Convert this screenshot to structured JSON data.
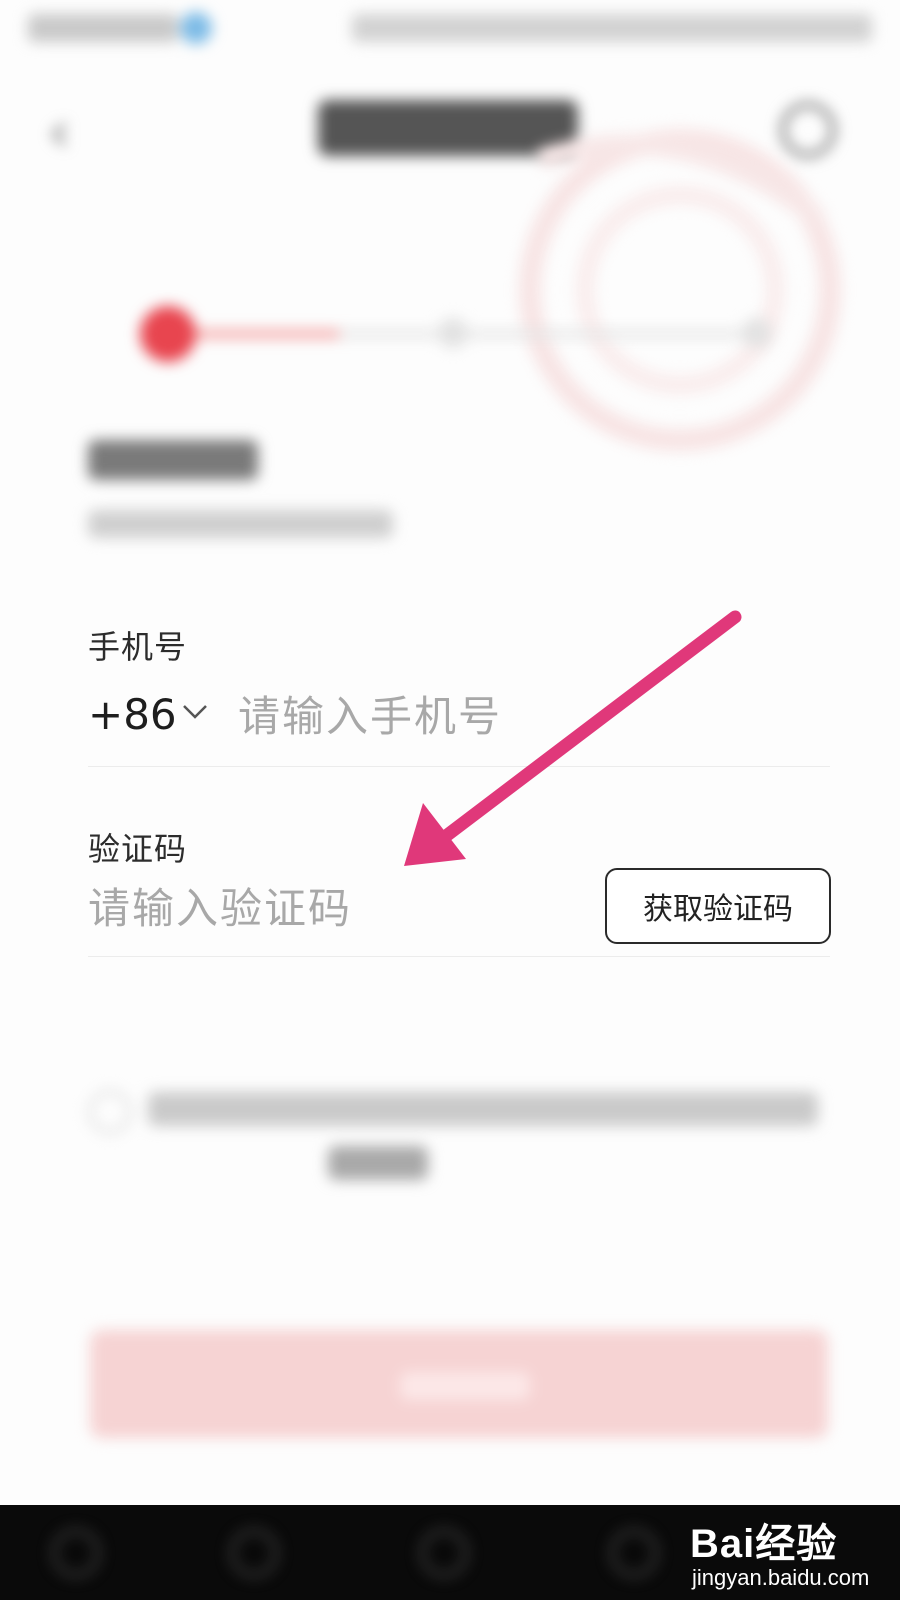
{
  "phone": {
    "label": "手机号",
    "country_code": "+86",
    "placeholder": "请输入手机号",
    "value": ""
  },
  "code": {
    "label": "验证码",
    "placeholder": "请输入验证码",
    "value": "",
    "button_label": "获取验证码"
  },
  "colors": {
    "annotation_arrow": "#e0387a",
    "progress_active": "#e8454f",
    "next_button": "#f6d3d3"
  },
  "watermark": {
    "brand": "Bai经验",
    "url": "jingyan.baidu.com"
  }
}
